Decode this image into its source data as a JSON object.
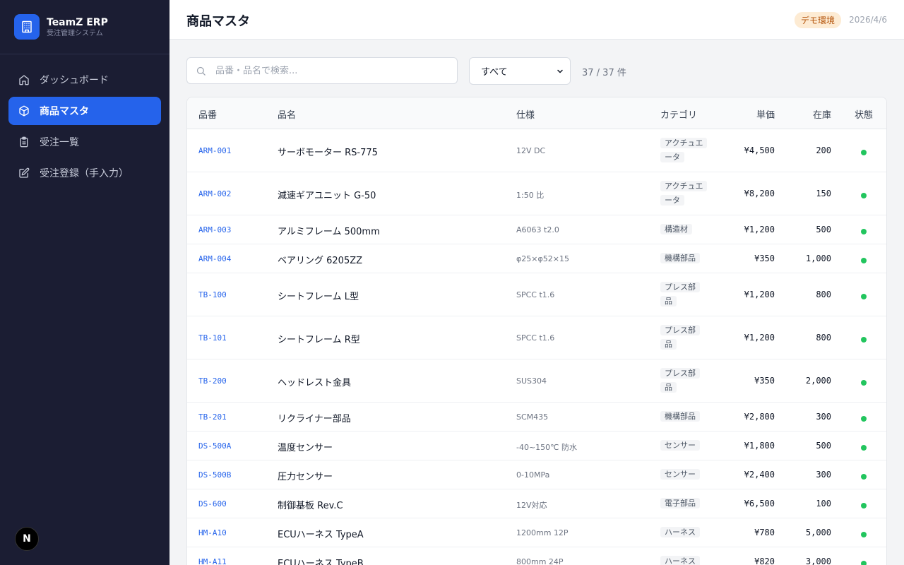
{
  "app": {
    "name": "TeamZ ERP",
    "subtitle": "受注管理システム",
    "badge_letter": "N"
  },
  "sidebar": {
    "items": [
      {
        "label": "ダッシュボード",
        "icon": "home-icon",
        "active": false
      },
      {
        "label": "商品マスタ",
        "icon": "box-icon",
        "active": true
      },
      {
        "label": "受注一覧",
        "icon": "clipboard-icon",
        "active": false
      },
      {
        "label": "受注登録（手入力）",
        "icon": "edit-icon",
        "active": false
      }
    ]
  },
  "header": {
    "title": "商品マスタ",
    "env_badge": "デモ環境",
    "date": "2026/4/6"
  },
  "toolbar": {
    "search_placeholder": "品番・品名で検索...",
    "search_value": "",
    "filter_selected": "すべて",
    "count": "37 / 37 件"
  },
  "table": {
    "columns": {
      "code": "品番",
      "name": "品名",
      "spec": "仕様",
      "category": "カテゴリ",
      "price": "単価",
      "stock": "在庫",
      "status": "状態"
    },
    "rows": [
      {
        "code": "ARM-001",
        "name": "サーボモーター RS-775",
        "spec": "12V DC",
        "category": "アクチュエータ",
        "price": "¥4,500",
        "stock": "200",
        "status": "active"
      },
      {
        "code": "ARM-002",
        "name": "減速ギアユニット G-50",
        "spec": "1:50 比",
        "category": "アクチュエータ",
        "price": "¥8,200",
        "stock": "150",
        "status": "active"
      },
      {
        "code": "ARM-003",
        "name": "アルミフレーム 500mm",
        "spec": "A6063 t2.0",
        "category": "構造材",
        "price": "¥1,200",
        "stock": "500",
        "status": "active"
      },
      {
        "code": "ARM-004",
        "name": "ベアリング 6205ZZ",
        "spec": "φ25×φ52×15",
        "category": "機構部品",
        "price": "¥350",
        "stock": "1,000",
        "status": "active"
      },
      {
        "code": "TB-100",
        "name": "シートフレーム L型",
        "spec": "SPCC t1.6",
        "category": "プレス部品",
        "price": "¥1,200",
        "stock": "800",
        "status": "active"
      },
      {
        "code": "TB-101",
        "name": "シートフレーム R型",
        "spec": "SPCC t1.6",
        "category": "プレス部品",
        "price": "¥1,200",
        "stock": "800",
        "status": "active"
      },
      {
        "code": "TB-200",
        "name": "ヘッドレスト金具",
        "spec": "SUS304",
        "category": "プレス部品",
        "price": "¥350",
        "stock": "2,000",
        "status": "active"
      },
      {
        "code": "TB-201",
        "name": "リクライナー部品",
        "spec": "SCM435",
        "category": "機構部品",
        "price": "¥2,800",
        "stock": "300",
        "status": "active"
      },
      {
        "code": "DS-500A",
        "name": "温度センサー",
        "spec": "-40~150℃ 防水",
        "category": "センサー",
        "price": "¥1,800",
        "stock": "500",
        "status": "active"
      },
      {
        "code": "DS-500B",
        "name": "圧力センサー",
        "spec": "0-10MPa",
        "category": "センサー",
        "price": "¥2,400",
        "stock": "300",
        "status": "active"
      },
      {
        "code": "DS-600",
        "name": "制御基板 Rev.C",
        "spec": "12V対応",
        "category": "電子部品",
        "price": "¥6,500",
        "stock": "100",
        "status": "active"
      },
      {
        "code": "HM-A10",
        "name": "ECUハーネス TypeA",
        "spec": "1200mm 12P",
        "category": "ハーネス",
        "price": "¥780",
        "stock": "5,000",
        "status": "active"
      },
      {
        "code": "HM-A11",
        "name": "ECUハーネス TypeB",
        "spec": "800mm 24P",
        "category": "ハーネス",
        "price": "¥820",
        "stock": "3,000",
        "status": "active"
      }
    ]
  },
  "colors": {
    "sidebar_bg": "#1b1d33",
    "accent": "#2563eb",
    "status_active": "#22c55e",
    "env_badge_bg": "#fdebd3"
  }
}
